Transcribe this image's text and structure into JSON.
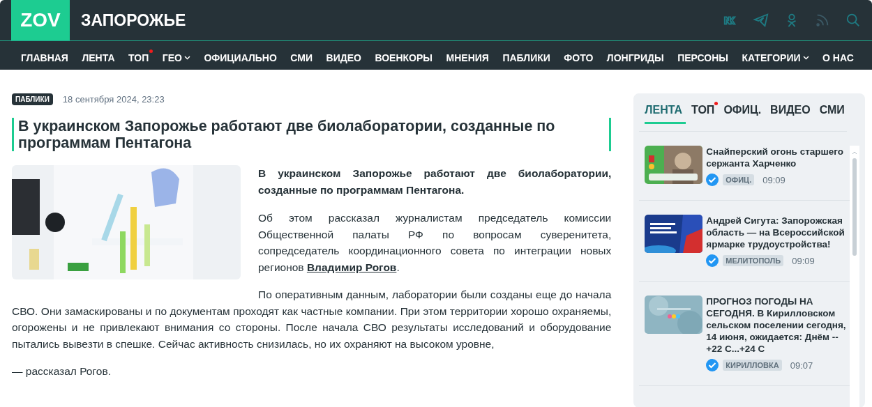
{
  "header": {
    "logo": "ZOV",
    "site_title": "ЗАПОРОЖЬЕ"
  },
  "nav": [
    {
      "label": "ГЛАВНАЯ",
      "new_mark": false,
      "dropdown": false
    },
    {
      "label": "ЛЕНТА",
      "new_mark": false,
      "dropdown": false
    },
    {
      "label": "ТОП",
      "new_mark": true,
      "dropdown": false
    },
    {
      "label": "ГЕО",
      "new_mark": false,
      "dropdown": true
    },
    {
      "label": "ОФИЦИАЛЬНО",
      "new_mark": false,
      "dropdown": false
    },
    {
      "label": "СМИ",
      "new_mark": false,
      "dropdown": false
    },
    {
      "label": "ВИДЕО",
      "new_mark": false,
      "dropdown": false
    },
    {
      "label": "ВОЕНКОРЫ",
      "new_mark": false,
      "dropdown": false
    },
    {
      "label": "МНЕНИЯ",
      "new_mark": false,
      "dropdown": false
    },
    {
      "label": "ПАБЛИКИ",
      "new_mark": false,
      "dropdown": false
    },
    {
      "label": "ФОТО",
      "new_mark": false,
      "dropdown": false
    },
    {
      "label": "ЛОНГРИДЫ",
      "new_mark": false,
      "dropdown": false
    },
    {
      "label": "ПЕРСОНЫ",
      "new_mark": false,
      "dropdown": false
    },
    {
      "label": "КАТЕГОРИИ",
      "new_mark": false,
      "dropdown": true
    },
    {
      "label": "О НАС",
      "new_mark": false,
      "dropdown": false
    }
  ],
  "article": {
    "tag": "ПАБЛИКИ",
    "date": "18 сентября 2024, 23:23",
    "title": "В украинском Запорожье работают две биолаборатории, созданные по программам Пентагона",
    "lead": "В украинском Запорожье работают две биолаборатории, созданные по программам Пентагона.",
    "paragraphs": [
      {
        "before_link": "Об этом рассказал журналистам председатель комиссии Общественной палаты РФ по вопросам суверенитета, сопредседатель координационного совета по интеграции новых регионов ",
        "link": "Владимир Рогов",
        "after_link": "."
      },
      {
        "before_link": "По оперативным данным, лаборатории были созданы еще до начала СВО. Они замаскированы и по документам проходят как частные компании. При этом территории хорошо охраняемы, огорожены и не привлекают внимания со стороны. После начала СВО результаты исследований и оборудование пытались вывезти в спешке. Сейчас активность снизилась, но их охраняют на высоком уровне,"
      },
      {
        "before_link": "— рассказал Рогов."
      }
    ]
  },
  "sidebar": {
    "tabs": [
      {
        "label": "ЛЕНТА",
        "selected": true,
        "new_mark": false
      },
      {
        "label": "ТОП",
        "selected": false,
        "new_mark": true
      },
      {
        "label": "ОФИЦ.",
        "selected": false,
        "new_mark": false
      },
      {
        "label": "ВИДЕО",
        "selected": false,
        "new_mark": false
      },
      {
        "label": "СМИ",
        "selected": false,
        "new_mark": false
      }
    ],
    "news": [
      {
        "title": "Снайперский огонь старшего сержанта Харченко",
        "source": "ОФИЦ.",
        "time": "09:09"
      },
      {
        "title": "Андрей Сигута: Запорожская область — на Всероссийской ярмарке трудоустройства!",
        "source": "МЕЛИТОПОЛЬ",
        "time": "09:09"
      },
      {
        "title": "ПРОГНОЗ ПОГОДЫ НА СЕГОДНЯ. В Кирилловском сельском поселении сегодня, 14 июня, ожидается: Днём --  +22 С...+24 С",
        "source": "КИРИЛЛОВКА",
        "time": "09:07"
      }
    ]
  }
}
